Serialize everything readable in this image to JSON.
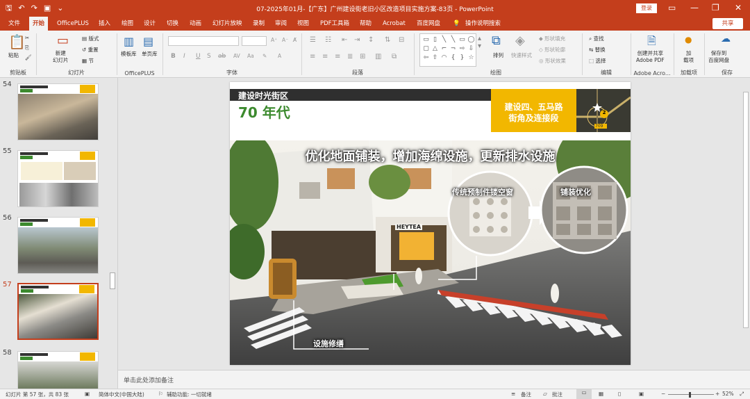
{
  "titlebar": {
    "autosave_label": "",
    "title": "07-2025年01月-【广东】广州建设街老旧小区改造项目实施方案-83页 - PowerPoint",
    "login_label": "登录"
  },
  "tabs": [
    {
      "label": "文件"
    },
    {
      "label": "开始"
    },
    {
      "label": "OfficePLUS"
    },
    {
      "label": "插入"
    },
    {
      "label": "绘图"
    },
    {
      "label": "设计"
    },
    {
      "label": "切换"
    },
    {
      "label": "动画"
    },
    {
      "label": "幻灯片放映"
    },
    {
      "label": "录制"
    },
    {
      "label": "审阅"
    },
    {
      "label": "视图"
    },
    {
      "label": "PDF工具箱"
    },
    {
      "label": "帮助"
    },
    {
      "label": "Acrobat"
    },
    {
      "label": "百度网盘"
    },
    {
      "label": "操作说明搜索"
    }
  ],
  "share_label": "共享",
  "ribbon": {
    "clipboard": {
      "paste": "粘贴",
      "group": "剪贴板"
    },
    "slides": {
      "new_slide": "新建\n幻灯片",
      "layout": "版式",
      "reset": "重置",
      "section": "节",
      "group": "幻灯片"
    },
    "officeplus": {
      "templates": "模板库",
      "single": "单页库",
      "group": "OfficePLUS"
    },
    "font": {
      "group": "字体",
      "bold": "B",
      "italic": "I",
      "underline": "U",
      "strike": "S",
      "spacing": "ab"
    },
    "paragraph": {
      "group": "段落"
    },
    "drawing": {
      "arrange": "排列",
      "quick_styles": "快速样式",
      "fill": "形状填充",
      "outline": "形状轮廓",
      "effects": "形状效果",
      "group": "绘图"
    },
    "editing": {
      "find": "查找",
      "replace": "替换",
      "select": "选择",
      "group": "编辑"
    },
    "adobe": {
      "create": "创建并共享\nAdobe PDF",
      "group": "Adobe Acro..."
    },
    "addins": {
      "add": "加\n载项",
      "group": "加载项"
    },
    "save": {
      "save_baidu": "保存到\n百度网盘",
      "group": "保存"
    }
  },
  "thumbnails": [
    {
      "number": "54"
    },
    {
      "number": "55"
    },
    {
      "number": "56"
    },
    {
      "number": "57",
      "selected": true
    },
    {
      "number": "58"
    }
  ],
  "slide": {
    "section_title": "建设时光街区",
    "era": "70 年代",
    "yellow_box_line1": "建设四、五马路",
    "yellow_box_line2": "街角及连接段",
    "minimap_badge": "2",
    "minimap_code": "709",
    "heading": "优化地面铺装，增加海绵设施，更新排水设施",
    "label_screen": "传统预制件镂空窗",
    "label_paving": "铺装优化",
    "label_facility": "设施修缮",
    "shop_sign": "HEYTEA"
  },
  "notes_placeholder": "单击此处添加备注",
  "status": {
    "slide_info": "幻灯片 第 57 张，共 83 张",
    "language": "简体中文(中国大陆)",
    "accessibility": "辅助功能: 一切就绪",
    "notes": "备注",
    "comments": "批注",
    "zoom": "52%"
  },
  "colors": {
    "accent": "#c43e1c",
    "slide_green": "#3c8a2e",
    "slide_yellow": "#f2b700",
    "slide_dark": "#2f2f2f"
  }
}
